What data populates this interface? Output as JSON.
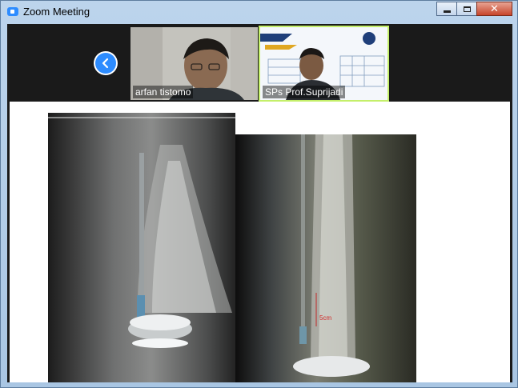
{
  "window": {
    "title": "Zoom Meeting",
    "icon": "zoom-app-icon",
    "controls": {
      "minimize": "minimize-icon",
      "maximize": "maximize-icon",
      "close": "close-icon"
    }
  },
  "gallery": {
    "prev_icon": "chevron-left-icon",
    "participants": [
      {
        "name": "arfan tistomo",
        "active_speaker": false
      },
      {
        "name": "SPs Prof.Suprijadi",
        "active_speaker": true,
        "backdrop_text": "SEKOLAH PASCASARJANA"
      }
    ]
  },
  "shared_content": {
    "images": [
      {
        "description_icon": "bubble-column-photo-1"
      },
      {
        "description_icon": "bubble-column-photo-2",
        "annotation": "5cm"
      }
    ]
  },
  "colors": {
    "accent": "#2d8cff",
    "speaker_highlight": "#c4ef6a"
  }
}
